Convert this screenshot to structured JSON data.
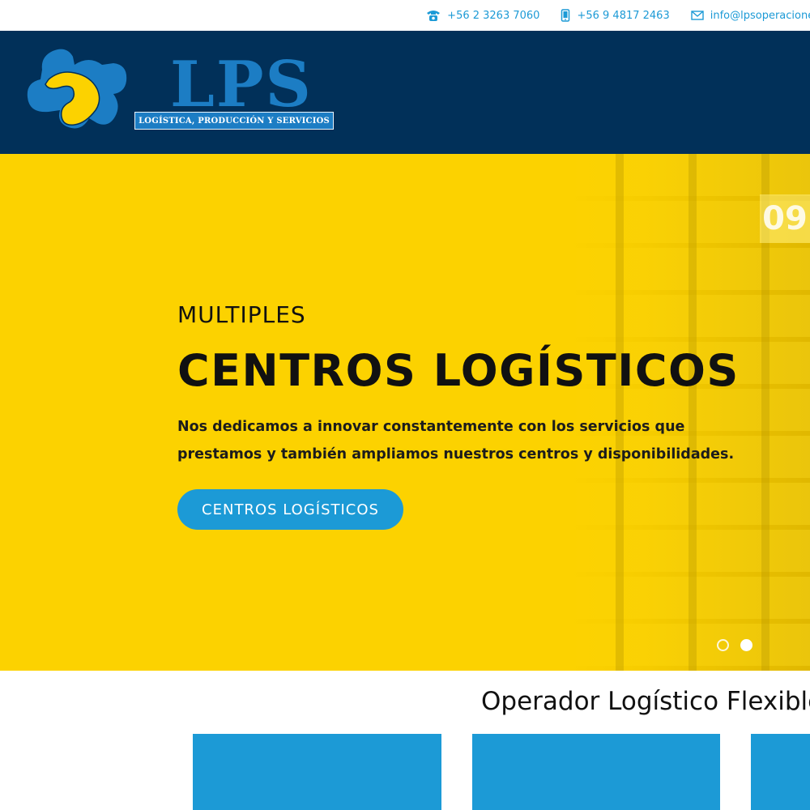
{
  "topbar": {
    "contacts": [
      {
        "icon": "telephone-icon",
        "text": "+56 2 3263 7060"
      },
      {
        "icon": "mobile-phone-icon",
        "text": "+56 9 4817 2463"
      },
      {
        "icon": "email-icon",
        "text": "info@lpsoperaciones"
      }
    ]
  },
  "header": {
    "logo_text": "LPS",
    "logo_tagline": "LOGÍSTICA, PRODUCCIÓN Y SERVICIOS",
    "logo_colors": {
      "yellow": "#fcd200",
      "blue": "#1c7dc4"
    }
  },
  "hero": {
    "eyebrow": "MULTIPLES",
    "title": "CENTROS LOGÍSTICOS",
    "text": "Nos dedicamos a innovar constantemente con los servicios que prestamos y también ampliamos nuestros centros y disponibilidades.",
    "button_label": "CENTROS LOGÍSTICOS",
    "photo_sign": "09",
    "slides_total": 2,
    "active_slide": 2
  },
  "section": {
    "title": "Operador Logístico Flexible"
  },
  "colors": {
    "header_bg": "#013059",
    "hero_bg": "#fcd200",
    "accent": "#1c9ad6"
  }
}
